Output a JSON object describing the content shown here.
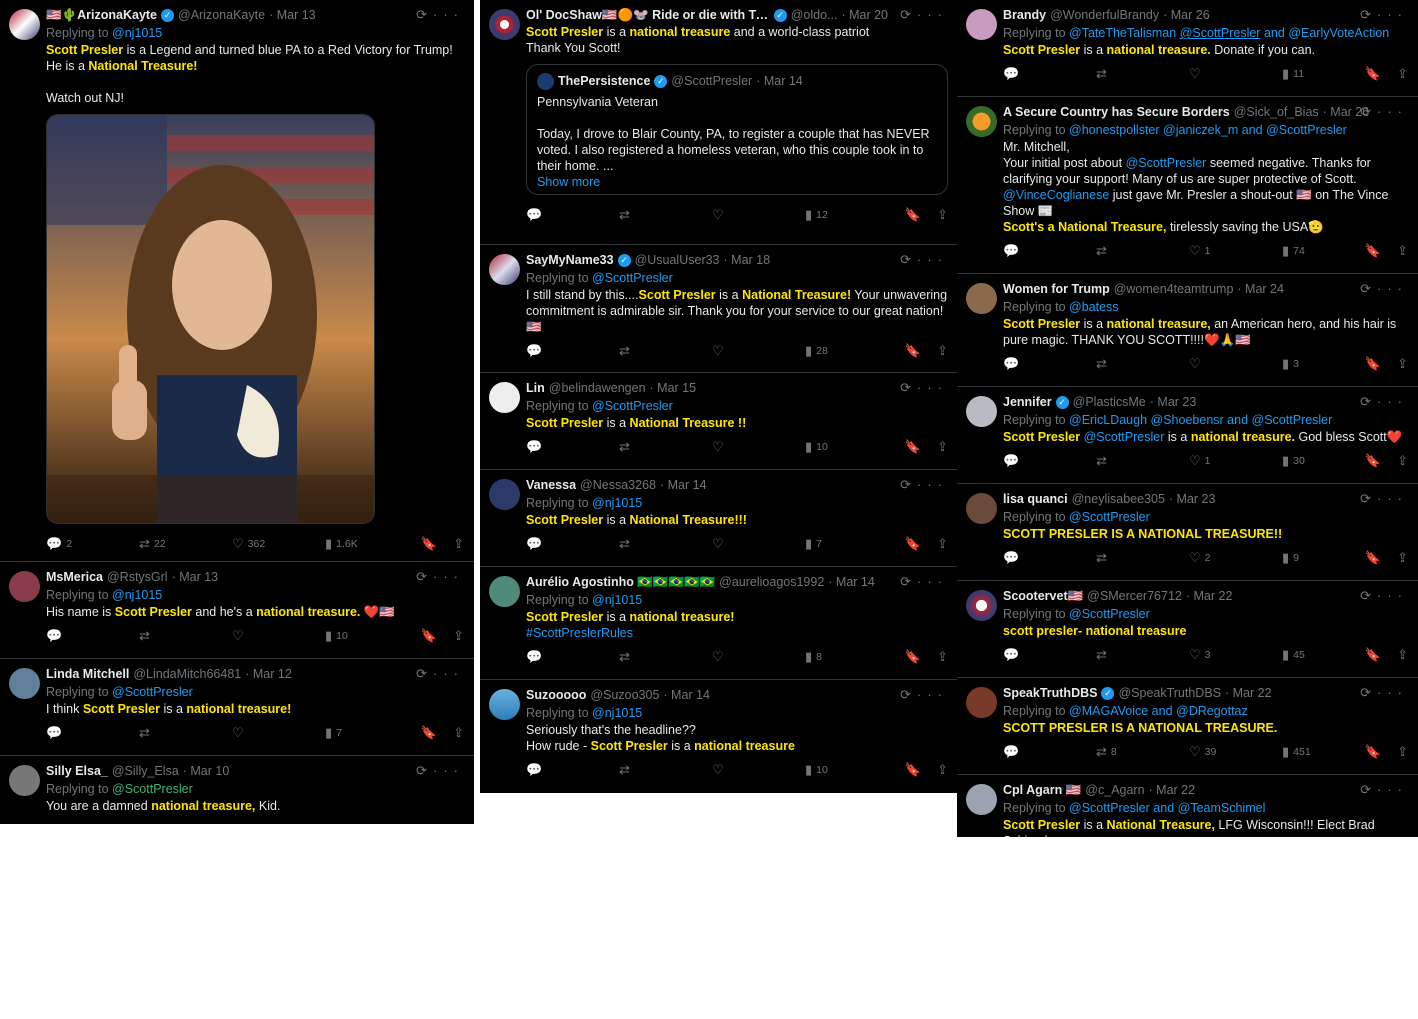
{
  "col1": [
    {
      "name": "🇺🇸🌵ArizonaKayte",
      "verified": true,
      "handle": "@ArizonaKayte",
      "date": "· Mar 13",
      "replying": "Replying to",
      "mentions": [
        "@nj1015"
      ],
      "body": [
        "Scott Presler",
        "is a Legend and turned blue PA to a Red Victory for Trump!",
        "He is a",
        "National Treasure!",
        "Watch out NJ!"
      ],
      "stats": {
        "replies": "2",
        "retweets": "22",
        "likes": "362",
        "views": "1.6K"
      }
    },
    {
      "name": "MsMerica",
      "handle": "@RstysGrl",
      "date": "· Mar 13",
      "replying": "Replying to",
      "mentions": [
        "@nj1015"
      ],
      "body": [
        "His name is",
        "Scott Presler",
        "and he's a",
        "national treasure.",
        "❤️🇺🇸"
      ],
      "stats": {
        "replies": "",
        "retweets": "",
        "likes": "",
        "views": "10"
      }
    },
    {
      "name": "Linda Mitchell",
      "handle": "@LindaMitch66481",
      "date": "· Mar 12",
      "replying": "Replying to",
      "mentions": [
        "@ScottPresler"
      ],
      "body": [
        "I think",
        "Scott Presler",
        "is a",
        "national treasure!"
      ],
      "stats": {
        "replies": "",
        "retweets": "",
        "likes": "",
        "views": "7"
      }
    },
    {
      "name": "Silly Elsa_",
      "handle": "@Silly_Elsa",
      "date": "· Mar 10",
      "replying": "Replying to",
      "mentions": [
        "@ScottPresler"
      ],
      "body": [
        "You are a damned",
        "national treasure,",
        "Kid."
      ]
    }
  ],
  "col2": [
    {
      "name": "Ol' DocShaw🇺🇸🟠🐭 Ride or die with Tru...",
      "verified": true,
      "handle": "@oldo...",
      "date": "· Mar 20",
      "body": [
        "Scott Presler",
        "is a",
        "national treasure",
        "and a world-class patriot",
        "Thank You Scott!"
      ],
      "quote": {
        "name": "ThePersistence",
        "handle": "@ScottPresler",
        "date": "· Mar 14",
        "line1": "Pennsylvania Veteran",
        "line2": "Today, I drove to Blair County, PA, to register a couple that has NEVER voted. I also registered a homeless veteran, who this couple took in to their home. ...",
        "more": "Show more"
      },
      "stats": {
        "views": "12"
      }
    },
    {
      "name": "SayMyName33",
      "verified": true,
      "handle": "@UsualUser33",
      "date": "· Mar 18",
      "replying": "Replying to",
      "mentions": [
        "@ScottPresler"
      ],
      "body": [
        "I still stand by this....",
        "Scott Presler",
        "is a",
        "National Treasure!",
        "Your unwavering commitment is admirable sir. Thank you for your service to our great nation! 🇺🇸"
      ],
      "stats": {
        "views": "28"
      }
    },
    {
      "name": "Lin",
      "handle": "@belindawengen",
      "date": "· Mar 15",
      "replying": "Replying to",
      "mentions": [
        "@ScottPresler"
      ],
      "body": [
        "Scott Presler",
        "is a",
        "National Treasure !!"
      ],
      "stats": {
        "views": "10"
      }
    },
    {
      "name": "Vanessa",
      "handle": "@Nessa3268",
      "date": "· Mar 14",
      "replying": "Replying to",
      "mentions": [
        "@nj1015"
      ],
      "body": [
        "Scott Presler",
        "is a",
        "National Treasure!!!"
      ],
      "stats": {
        "views": "7"
      }
    },
    {
      "name": "Aurélio Agostinho 🇧🇷🇧🇷🇧🇷🇧🇷🇧🇷",
      "handle": "@aurelioagos1992",
      "date": "· Mar 14",
      "replying": "Replying to",
      "mentions": [
        "@nj1015"
      ],
      "body": [
        "Scott Presler",
        "is a",
        "national treasure!",
        "#ScottPreslerRules"
      ],
      "stats": {
        "views": "8"
      }
    },
    {
      "name": "Suzooooo",
      "handle": "@Suzoo305",
      "date": "· Mar 14",
      "replying": "Replying to",
      "mentions": [
        "@nj1015"
      ],
      "body": [
        "Seriously that's the headline??",
        "How rude -",
        "Scott Presler",
        "is a",
        "national treasure"
      ],
      "stats": {
        "views": "10"
      }
    }
  ],
  "col3": [
    {
      "name": "Brandy",
      "handle": "@WonderfulBrandy",
      "date": "· Mar 26",
      "replying": "Replying to",
      "mentions": [
        "@TateTheTalisman",
        "@ScottPresler",
        "and",
        "@EarlyVoteAction"
      ],
      "body": [
        "Scott Presler",
        "is a",
        "national treasure.",
        "Donate if you can."
      ],
      "stats": {
        "replies": "",
        "retweets": "",
        "likes": "",
        "views": "11"
      }
    },
    {
      "name": "A Secure Country has Secure Borders",
      "handle": "@Sick_of_Bias",
      "date": "· Mar 26",
      "replying": "Replying to",
      "mentions": [
        "@honestpollster",
        "@janiczek_m",
        "and",
        "@ScottPresler"
      ],
      "body": [
        "Mr. Mitchell,",
        "Your initial post about",
        "@ScottPresler",
        "seemed negative. Thanks for clarifying your support! Many of us are super protective of Scott.",
        "@VinceCoglianese",
        "just gave Mr. Presler a shout-out 🇺🇸 on The Vince Show 📰",
        "Scott's a National Treasure,",
        "tirelessly saving the USA🫡"
      ],
      "stats": {
        "likes": "1",
        "views": "74"
      }
    },
    {
      "name": "Women for Trump",
      "handle": "@women4teamtrump",
      "date": "· Mar 24",
      "replying": "Replying to",
      "mentions": [
        "@batess"
      ],
      "body": [
        "Scott Presler",
        "is a",
        "national treasure,",
        "an American hero, and his hair is pure magic. THANK YOU SCOTT!!!!❤️🙏🇺🇸"
      ],
      "stats": {
        "views": "3"
      }
    },
    {
      "name": "Jennifer",
      "verified": true,
      "handle": "@PlasticsMe",
      "date": "· Mar 23",
      "replying": "Replying to",
      "mentions": [
        "@EricLDaugh",
        "@Shoebensr",
        "and",
        "@ScottPresler"
      ],
      "body": [
        "Scott Presler",
        "@ScottPresler",
        "is a",
        "national treasure.",
        "God bless Scott❤️"
      ],
      "stats": {
        "likes": "1",
        "views": "30"
      }
    },
    {
      "name": "lisa quanci",
      "handle": "@neylisabee305",
      "date": "· Mar 23",
      "replying": "Replying to",
      "mentions": [
        "@ScottPresler"
      ],
      "body": [
        "SCOTT PRESLER IS A NATIONAL TREASURE!!"
      ],
      "stats": {
        "likes": "2",
        "views": "9"
      }
    },
    {
      "name": "Scootervet🇺🇸",
      "handle": "@SMercer76712",
      "date": "· Mar 22",
      "replying": "Replying to",
      "mentions": [
        "@ScottPresler"
      ],
      "body": [
        "scott presler- national treasure"
      ],
      "stats": {
        "likes": "3",
        "views": "45"
      }
    },
    {
      "name": "SpeakTruthDBS",
      "verified": true,
      "handle": "@SpeakTruthDBS",
      "date": "· Mar 22",
      "replying": "Replying to",
      "mentions": [
        "@MAGAVoice",
        "and",
        "@DRegottaz"
      ],
      "body": [
        "SCOTT PRESLER IS A NATIONAL TREASURE."
      ],
      "stats": {
        "retweets": "8",
        "likes": "39",
        "views": "451"
      }
    },
    {
      "name": "Cpl Agarn 🇺🇸",
      "handle": "@c_Agarn",
      "date": "· Mar 22",
      "replying": "Replying to",
      "mentions": [
        "@ScottPresler",
        "and",
        "@TeamSchimel"
      ],
      "body": [
        "Scott Presler",
        "is a",
        "National Treasure,",
        "LFG Wisconsin!!! Elect Brad Schimel"
      ]
    }
  ],
  "icons": {
    "grok": "grok-icon",
    "more": "more-icon",
    "reply": "reply-icon",
    "retweet": "retweet-icon",
    "like": "like-icon",
    "views": "views-icon",
    "bookmark": "bookmark-icon",
    "share": "share-icon"
  },
  "colors": {
    "background": "#000000",
    "text": "#e7e9ea",
    "muted": "#71767b",
    "link": "#1d9bf0",
    "highlight": "#ffe600",
    "divider": "#2f3336"
  }
}
